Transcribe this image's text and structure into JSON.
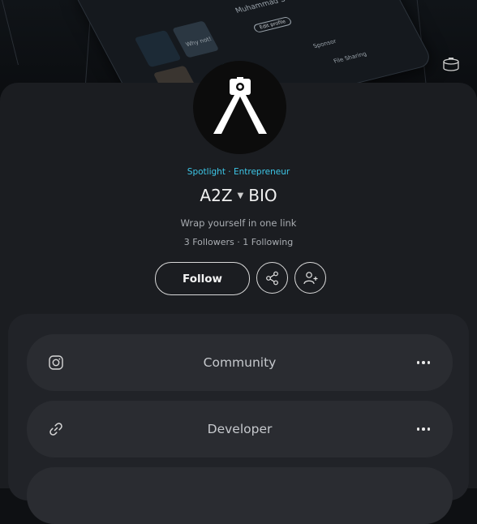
{
  "profile": {
    "category": "Spotlight · Entrepreneur",
    "name": "A2Z",
    "name_suffix": "BIO",
    "bio": "Wrap yourself in one link",
    "stats": "3 Followers · 1 Following"
  },
  "actions": {
    "follow_label": "Follow",
    "share_icon": "share-icon",
    "add_friend_icon": "add-user-icon"
  },
  "banner_mockup": {
    "name_text": "Muhammad S",
    "edit_profile": "Edit profile",
    "why_not": "Why not!",
    "sponsor": "Sponsor",
    "file_sharing": "File Sharing"
  },
  "links": [
    {
      "label": "Community",
      "icon": "instagram-icon"
    },
    {
      "label": "Developer",
      "icon": "link-icon"
    }
  ],
  "colors": {
    "accent": "#3dc7e8",
    "background": "#0e1013",
    "panel": "#1b1d21",
    "card": "#212328",
    "item": "#2a2c31"
  }
}
